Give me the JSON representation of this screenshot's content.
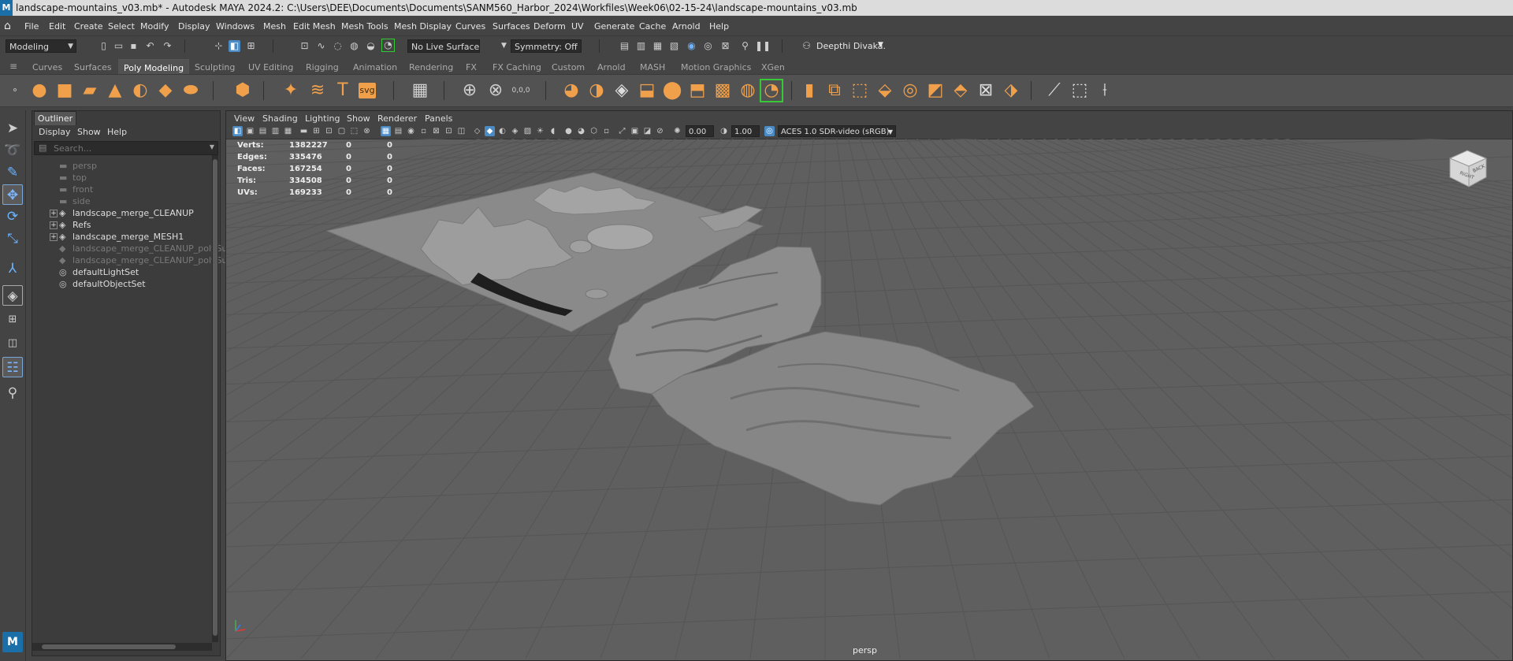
{
  "window": {
    "title": "landscape-mountains_v03.mb* - Autodesk MAYA 2024.2: C:\\Users\\DEE\\Documents\\Documents\\SANM560_Harbor_2024\\Workfiles\\Week06\\02-15-24\\landscape-mountains_v03.mb",
    "logo": "M"
  },
  "menubar": {
    "items": [
      "File",
      "Edit",
      "Create",
      "Select",
      "Modify",
      "Display",
      "Windows",
      "Mesh",
      "Edit Mesh",
      "Mesh Tools",
      "Mesh Display",
      "Curves",
      "Surfaces",
      "Deform",
      "UV",
      "Generate",
      "Cache",
      "Arnold",
      "Help"
    ]
  },
  "statusline": {
    "mode": "Modeling",
    "live_surface": "No Live Surface",
    "symmetry": "Symmetry: Off",
    "user": "Deepthi Divaka."
  },
  "shelf": {
    "tabs": [
      "Curves",
      "Surfaces",
      "Poly Modeling",
      "Sculpting",
      "UV Editing",
      "Rigging",
      "Animation",
      "Rendering",
      "FX",
      "FX Caching",
      "Custom",
      "Arnold",
      "MASH",
      "Motion Graphics",
      "XGen"
    ],
    "active_tab": "Poly Modeling",
    "text_icon": "T",
    "svg_icon": "svg",
    "coords_icon": "0,0,0"
  },
  "outliner": {
    "tab": "Outliner",
    "menu": [
      "Display",
      "Show",
      "Help"
    ],
    "search_placeholder": "Search...",
    "items": [
      {
        "label": "persp",
        "icon": "camera-icon",
        "dim": true,
        "expandable": false
      },
      {
        "label": "top",
        "icon": "camera-icon",
        "dim": true,
        "expandable": false
      },
      {
        "label": "front",
        "icon": "camera-icon",
        "dim": true,
        "expandable": false
      },
      {
        "label": "side",
        "icon": "camera-icon",
        "dim": true,
        "expandable": false
      },
      {
        "label": "landscape_merge_CLEANUP",
        "icon": "mesh-icon",
        "dim": false,
        "expandable": true
      },
      {
        "label": "Refs",
        "icon": "mesh-icon",
        "dim": false,
        "expandable": true
      },
      {
        "label": "landscape_merge_MESH1",
        "icon": "mesh-icon",
        "dim": false,
        "expandable": true
      },
      {
        "label": "landscape_merge_CLEANUP_polySurf",
        "icon": "shape-icon",
        "dim": true,
        "expandable": false
      },
      {
        "label": "landscape_merge_CLEANUP_polySurf",
        "icon": "shape-icon",
        "dim": true,
        "expandable": false
      },
      {
        "label": "defaultLightSet",
        "icon": "set-icon",
        "dim": false,
        "expandable": false
      },
      {
        "label": "defaultObjectSet",
        "icon": "set-icon",
        "dim": false,
        "expandable": false
      }
    ]
  },
  "viewport": {
    "menu": [
      "View",
      "Shading",
      "Lighting",
      "Show",
      "Renderer",
      "Panels"
    ],
    "exposure": "0.00",
    "gamma": "1.00",
    "color_space": "ACES 1.0 SDR-video (sRGB)",
    "camera": "persp",
    "hud": [
      {
        "label": "Verts:",
        "v1": "1382227",
        "v2": "0",
        "v3": "0"
      },
      {
        "label": "Edges:",
        "v1": "335476",
        "v2": "0",
        "v3": "0"
      },
      {
        "label": "Faces:",
        "v1": "167254",
        "v2": "0",
        "v3": "0"
      },
      {
        "label": "Tris:",
        "v1": "334508",
        "v2": "0",
        "v3": "0"
      },
      {
        "label": "UVs:",
        "v1": "169233",
        "v2": "0",
        "v3": "0"
      }
    ],
    "viewcube": {
      "face_a": "RIGHT",
      "face_b": "BACK"
    }
  },
  "colors": {
    "accent": "#4a8bc5",
    "shelf_icon": "#f0a04b",
    "viewport_bg": "#5f5f5f",
    "highlight": "#37c837"
  }
}
